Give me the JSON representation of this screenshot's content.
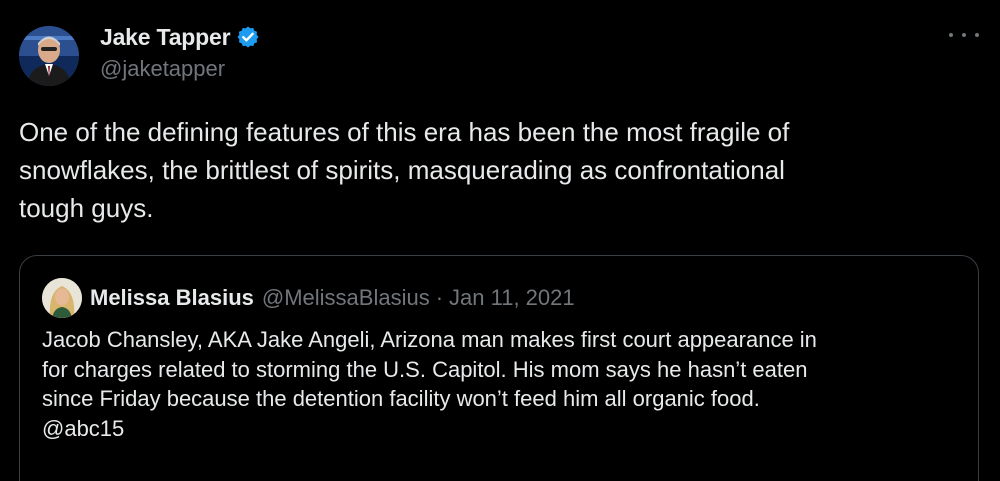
{
  "tweet": {
    "author": {
      "name": "Jake Tapper",
      "handle": "@jaketapper",
      "verified": true
    },
    "more_icon": "more-horizontal-icon",
    "text": "One of the defining features of this era has been the most fragile of\nsnowflakes, the brittlest of spirits, masquerading as confrontational\ntough guys."
  },
  "quoted_tweet": {
    "author": {
      "name": "Melissa Blasius",
      "handle": "@MelissaBlasius"
    },
    "separator": "·",
    "date": "Jan 11, 2021",
    "text": "Jacob Chansley, AKA Jake Angeli, Arizona man makes first court appearance in\nfor charges related to storming the U.S. Capitol. His mom says he hasn’t eaten\nsince Friday because the detention facility won’t feed him all organic food.\n@abc15"
  },
  "colors": {
    "background": "#000000",
    "primary_text": "#e7e9ea",
    "secondary_text": "#71767b",
    "verified_badge": "#1d9bf0",
    "quote_border": "#3a3f44"
  }
}
